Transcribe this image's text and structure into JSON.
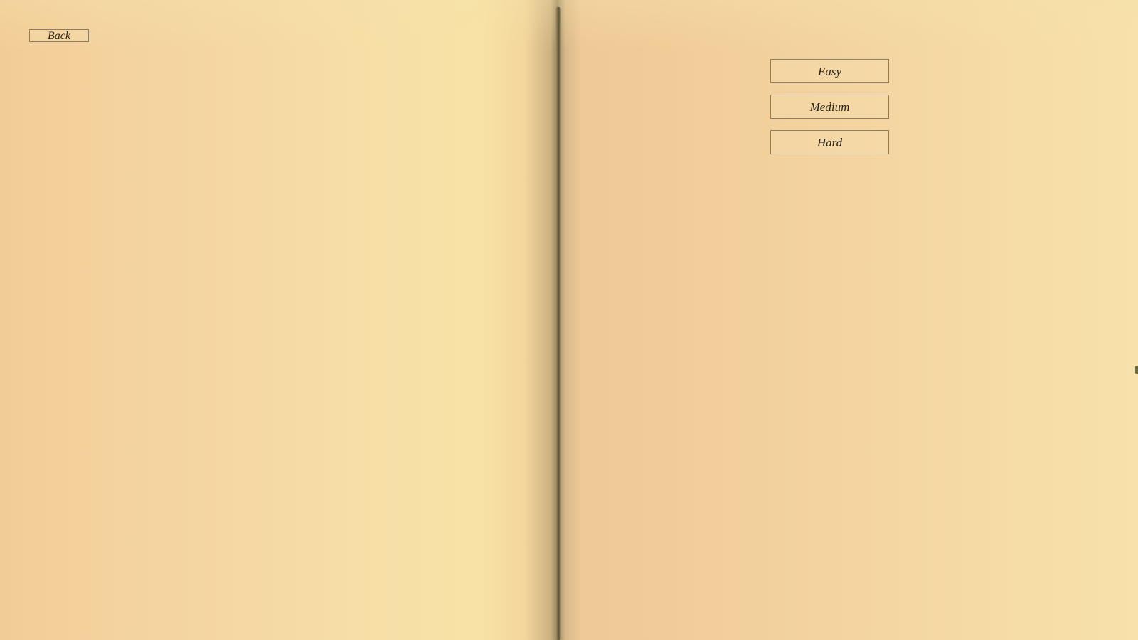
{
  "menu": {
    "back_label": "Back",
    "difficulty_options": [
      "Easy",
      "Medium",
      "Hard"
    ]
  },
  "colors": {
    "page_light": "#f8e2a5",
    "page_dark": "#f1cc98",
    "spine": "#6f6446",
    "cover": "#5d6a2a",
    "button_border": "#8a7f6c",
    "button_text": "#2a2118"
  },
  "icons": {
    "book": "open-book-background"
  }
}
